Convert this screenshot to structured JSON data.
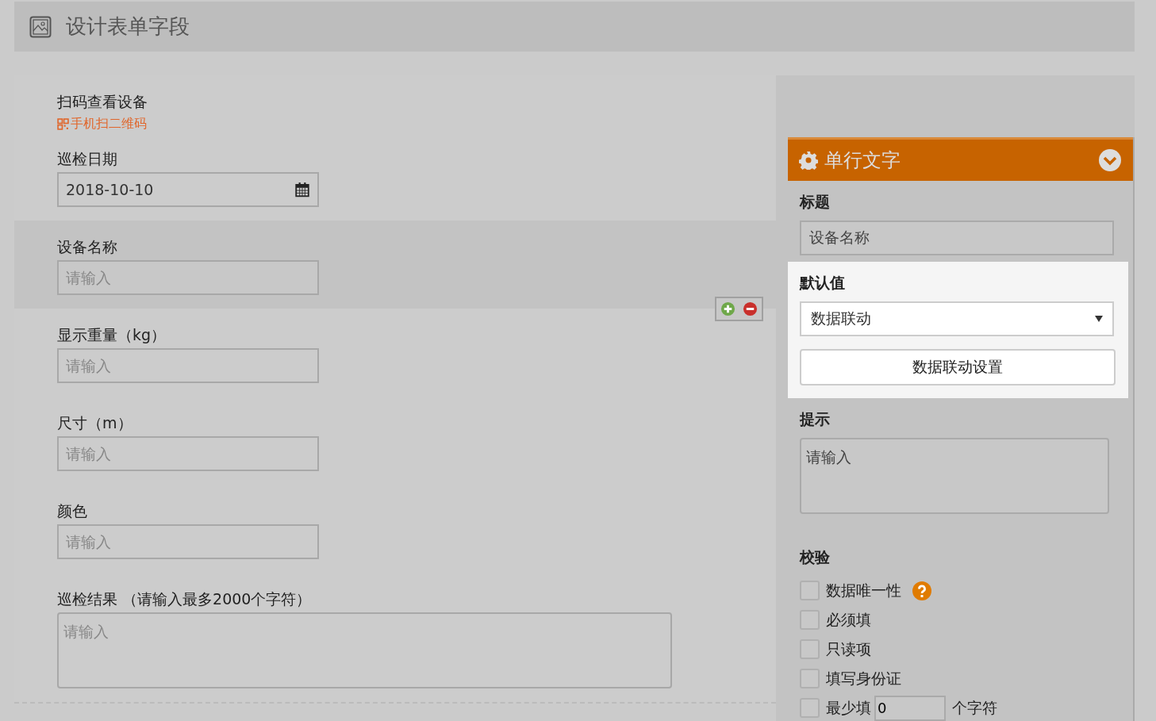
{
  "header": {
    "title": "设计表单字段"
  },
  "form": {
    "fields": [
      {
        "kind": "qr",
        "label": "扫码查看设备",
        "link": "手机扫二维码",
        "selected": false
      },
      {
        "kind": "date",
        "label": "巡检日期",
        "value": "2018-10-10",
        "selected": false
      },
      {
        "kind": "text",
        "label": "设备名称",
        "placeholder": "请输入",
        "selected": true
      },
      {
        "kind": "text",
        "label": "显示重量（kg）",
        "placeholder": "请输入",
        "selected": false
      },
      {
        "kind": "text",
        "label": "尺寸（m）",
        "placeholder": "请输入",
        "selected": false
      },
      {
        "kind": "text",
        "label": "颜色",
        "placeholder": "请输入",
        "selected": false
      },
      {
        "kind": "textarea",
        "label": "巡检结果 （请输入最多2000个字符）",
        "placeholder": "请输入",
        "selected": false
      }
    ]
  },
  "panel": {
    "title": "单行文字",
    "title_label": "标题",
    "title_value": "设备名称",
    "default_label": "默认值",
    "default_select": "数据联动",
    "default_button": "数据联动设置",
    "hint_label": "提示",
    "hint_placeholder": "请输入",
    "validation_label": "校验",
    "checks": [
      {
        "kind": "help",
        "label": "数据唯一性",
        "checked": false
      },
      {
        "kind": "plain",
        "label": "必须填",
        "checked": false
      },
      {
        "kind": "plain",
        "label": "只读项",
        "checked": false
      },
      {
        "kind": "plain",
        "label": "填写身份证",
        "checked": false
      },
      {
        "kind": "min",
        "label": "最少填",
        "checked": false,
        "value": "0",
        "suffix": "个字符"
      }
    ]
  }
}
